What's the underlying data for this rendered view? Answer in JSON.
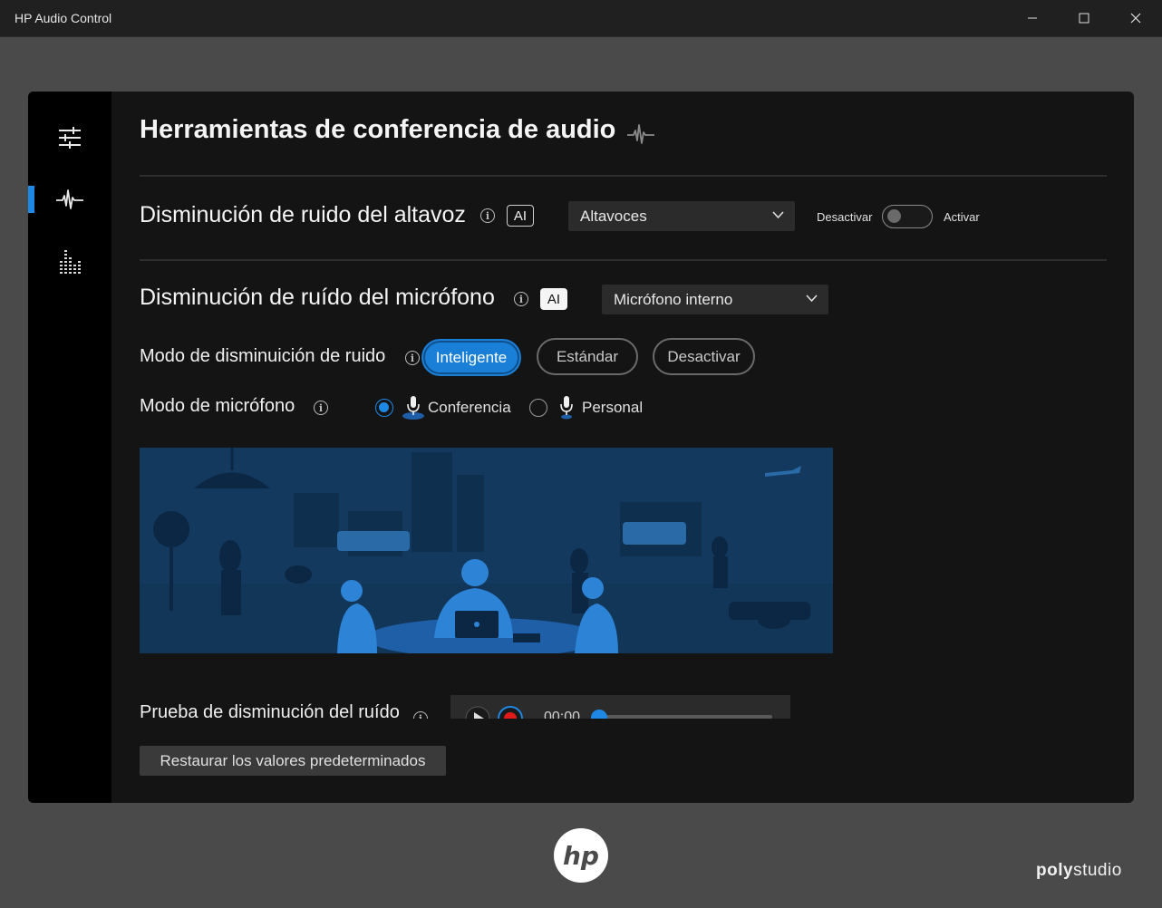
{
  "window": {
    "title": "HP Audio Control"
  },
  "sidebar": {
    "items": [
      {
        "name": "settings",
        "icon": "sliders-icon"
      },
      {
        "name": "audio-conference",
        "icon": "waveform-icon",
        "active": true
      },
      {
        "name": "equalizer",
        "icon": "equalizer-icon"
      }
    ],
    "accent": "#1e88e5"
  },
  "page": {
    "title": "Herramientas de conferencia de audio"
  },
  "speaker": {
    "label": "Disminución de ruido del altavoz",
    "ai_badge": "AI",
    "device": "Altavoces",
    "toggle_off_label": "Desactivar",
    "toggle_on_label": "Activar",
    "enabled": false
  },
  "microphone": {
    "label": "Disminución de ruído del micrófono",
    "ai_badge": "AI",
    "device": "Micrófono interno",
    "mode_label": "Modo de disminuición de ruido",
    "modes": [
      "Inteligente",
      "Estándar",
      "Desactivar"
    ],
    "selected_mode": "Inteligente",
    "mic_mode_label": "Modo de micrófono",
    "mic_modes": [
      "Conferencia",
      "Personal"
    ],
    "selected_mic_mode": "Conferencia"
  },
  "test": {
    "label": "Prueba de disminución del ruído",
    "time": "00:00"
  },
  "restore_button": "Restaurar los valores predeterminados",
  "branding": {
    "hp": "hp",
    "poly_bold": "poly",
    "poly_light": "studio"
  }
}
